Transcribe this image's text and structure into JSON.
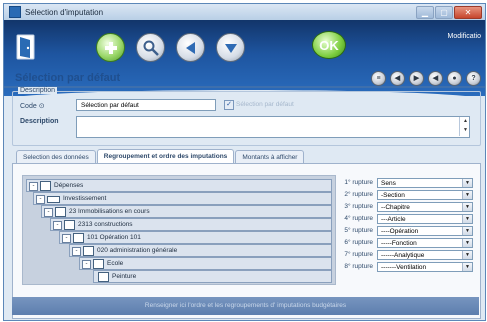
{
  "window": {
    "title": "Sélection d'imputation"
  },
  "toolbar": {
    "mode_label": "Modificatio",
    "ok_label": "OK"
  },
  "page": {
    "title": "Sélection par défaut"
  },
  "description": {
    "legend": "Description",
    "code_label": "Code",
    "code_value": "Sélection par défaut",
    "default_checkbox_label": "Sélection par défaut",
    "description_label": "Description",
    "description_value": ""
  },
  "tabs": [
    "Selection des données",
    "Regroupement et ordre des imputations",
    "Montants à afficher"
  ],
  "tree": {
    "rows": [
      {
        "toggle": "-",
        "label": "Dépenses"
      },
      {
        "toggle": "-",
        "label": "Investissement"
      },
      {
        "toggle": "-",
        "label": "23 Immobilisations en cours"
      },
      {
        "toggle": "-",
        "label": "2313 constructions"
      },
      {
        "toggle": "-",
        "label": "101 Opération 101"
      },
      {
        "toggle": "-",
        "label": "020 administration générale"
      },
      {
        "toggle": "-",
        "label": "Ecole"
      },
      {
        "toggle": "",
        "label": "Peinture"
      }
    ]
  },
  "ruptures": [
    {
      "label": "1° rupture",
      "value": "Sens"
    },
    {
      "label": "2° rupture",
      "value": "-Section"
    },
    {
      "label": "3° rupture",
      "value": "--Chapitre"
    },
    {
      "label": "4° rupture",
      "value": "---Article"
    },
    {
      "label": "5° rupture",
      "value": "----Opération"
    },
    {
      "label": "6° rupture",
      "value": "-----Fonction"
    },
    {
      "label": "7° rupture",
      "value": "------Analytique"
    },
    {
      "label": "8° rupture",
      "value": "-------Ventilation"
    }
  ],
  "status": {
    "text": "Renseigner ici l'ordre et les regroupements d' imputations budgétaires"
  },
  "colors": {
    "toolbar_top": "#12356a",
    "toolbar_bottom": "#2a6cbd",
    "title_blue": "#1f4f8f",
    "ok_green": "#7ccd3e"
  }
}
